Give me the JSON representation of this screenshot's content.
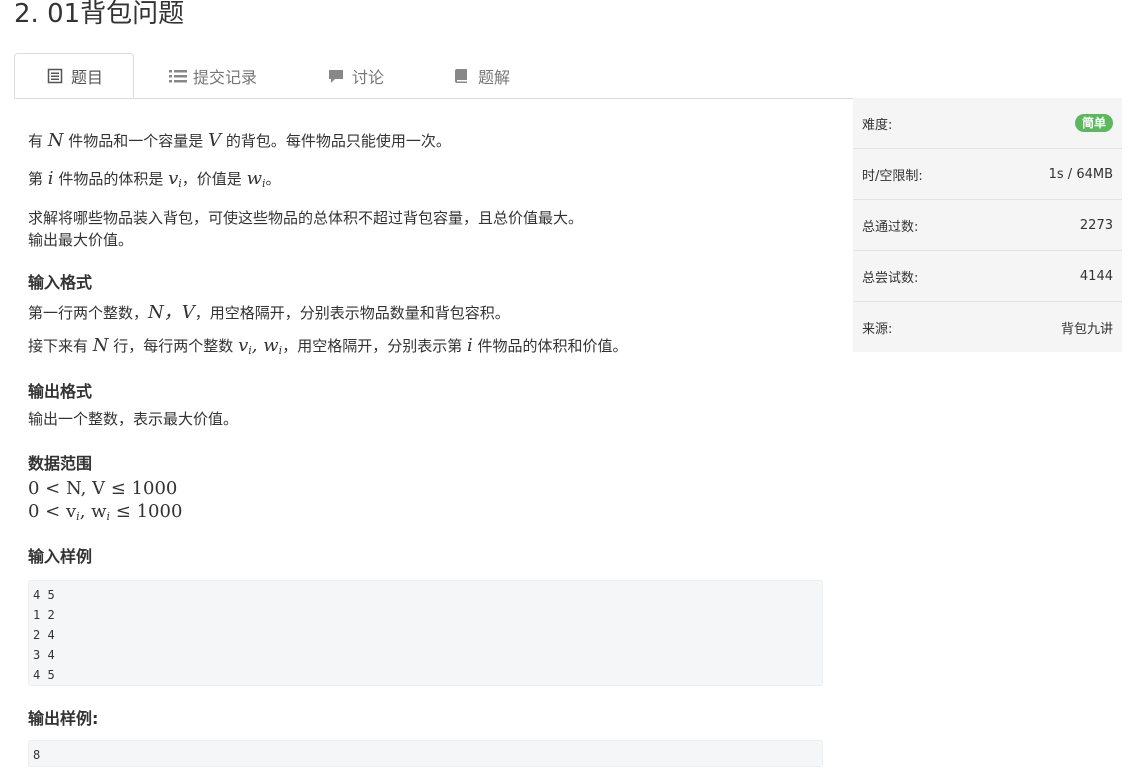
{
  "page_title": "2. 01背包问题",
  "tabs": [
    {
      "label": "题目",
      "icon": "list-icon"
    },
    {
      "label": "提交记录",
      "icon": "list-icon"
    },
    {
      "label": "讨论",
      "icon": "comment-icon"
    },
    {
      "label": "题解",
      "icon": "book-icon"
    }
  ],
  "problem": {
    "line1_pre": "有 ",
    "line1_var_n": "N",
    "line1_mid": " 件物品和一个容量是 ",
    "line1_var_v": "V",
    "line1_post": " 的背包。每件物品只能使用一次。",
    "line2_pre": "第 ",
    "line2_var_i": "i",
    "line2_mid": " 件物品的体积是 ",
    "line2_var_v": "v",
    "line2_sub": "i",
    "line2_mid2": "，价值是 ",
    "line2_var_w": "w",
    "line2_sub2": "i",
    "line2_post": "。",
    "line3": "求解将哪些物品装入背包，可使这些物品的总体积不超过背包容量，且总价值最大。",
    "line4": "输出最大价值。",
    "input_format_heading": "输入格式",
    "input_line1_pre": "第一行两个整数，",
    "input_line1_vars": "N，V",
    "input_line1_post": "，用空格隔开，分别表示物品数量和背包容积。",
    "input_line2_pre": "接下来有 ",
    "input_line2_var": "N",
    "input_line2_mid": " 行，每行两个整数 ",
    "input_line2_vars": "v",
    "input_line2_vars_b": "w",
    "input_line2_mid2": "，用空格隔开，分别表示第 ",
    "input_line2_var_i": "i",
    "input_line2_post": " 件物品的体积和价值。",
    "output_format_heading": "输出格式",
    "output_line": "输出一个整数，表示最大价值。",
    "range_heading": "数据范围",
    "range1": "0 < N, V ≤ 1000",
    "range2_a": "0 < v",
    "range2_b": ", w",
    "range2_c": " ≤ 1000",
    "sample_input_heading": "输入样例",
    "sample_input_lines": [
      "4 5",
      "1 2",
      "2 4",
      "3 4",
      "4 5"
    ],
    "sample_output_heading": "输出样例:",
    "sample_output_lines": [
      "8"
    ]
  },
  "sidebar": {
    "rows": [
      {
        "label": "难度:",
        "value": "简单"
      },
      {
        "label": "时/空限制:",
        "value": "1s / 64MB"
      },
      {
        "label": "总通过数:",
        "value": "2273"
      },
      {
        "label": "总尝试数:",
        "value": "4144"
      },
      {
        "label": "来源:",
        "value": "背包九讲"
      }
    ],
    "difficulty_color": "#5cb85c"
  }
}
